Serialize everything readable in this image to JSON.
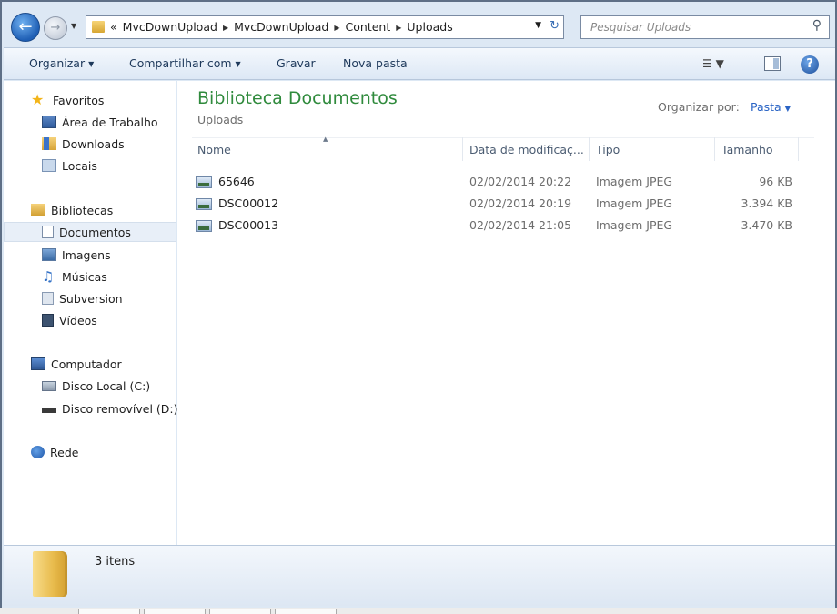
{
  "addressbar": {
    "breadcrumb_prefix": "«",
    "crumbs": [
      "MvcDownUpload",
      "MvcDownUpload",
      "Content",
      "Uploads"
    ],
    "search_placeholder": "Pesquisar Uploads"
  },
  "toolbar": {
    "organize": "Organizar",
    "share": "Compartilhar com",
    "burn": "Gravar",
    "new_folder": "Nova pasta"
  },
  "navpane": {
    "favorites": {
      "label": "Favoritos",
      "items": [
        "Área de Trabalho",
        "Downloads",
        "Locais"
      ]
    },
    "libraries": {
      "label": "Bibliotecas",
      "items": [
        "Documentos",
        "Imagens",
        "Músicas",
        "Subversion",
        "Vídeos"
      ]
    },
    "computer": {
      "label": "Computador",
      "items": [
        "Disco Local (C:)",
        "Disco removível (D:)"
      ]
    },
    "network": {
      "label": "Rede"
    }
  },
  "content": {
    "library_title": "Biblioteca Documentos",
    "library_subtitle": "Uploads",
    "arrange_by_label": "Organizar por:",
    "arrange_by_value": "Pasta",
    "columns": {
      "name": "Nome",
      "date": "Data de modificaç...",
      "type": "Tipo",
      "size": "Tamanho"
    },
    "files": [
      {
        "name": "65646",
        "date": "02/02/2014 20:22",
        "type": "Imagem JPEG",
        "size": "96 KB"
      },
      {
        "name": "DSC00012",
        "date": "02/02/2014 20:19",
        "type": "Imagem JPEG",
        "size": "3.394 KB"
      },
      {
        "name": "DSC00013",
        "date": "02/02/2014 21:05",
        "type": "Imagem JPEG",
        "size": "3.470 KB"
      }
    ]
  },
  "details": {
    "count": "3 itens"
  },
  "icons": {
    "back": "back-arrow-icon",
    "forward": "forward-arrow-icon",
    "search": "search-icon",
    "help": "help-icon"
  },
  "colors": {
    "title_green": "#2f8a3c",
    "link_blue": "#2a64c5",
    "chrome_blue": "#dde8f4"
  }
}
